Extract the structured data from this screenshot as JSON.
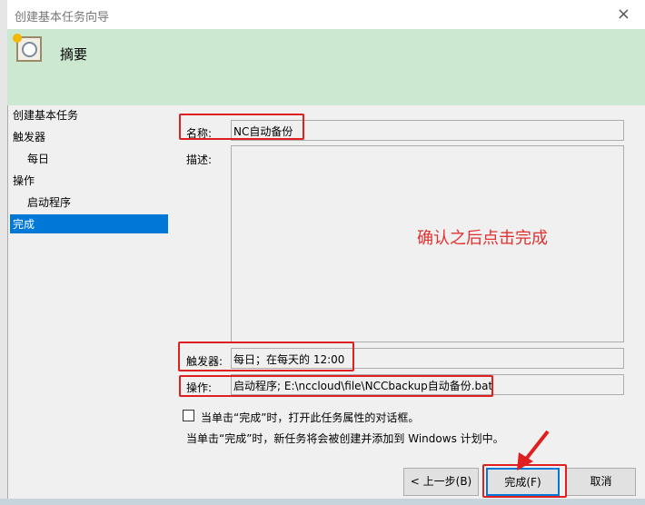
{
  "window": {
    "title": "创建基本任务向导",
    "close_icon": "×"
  },
  "header": {
    "title": "摘要"
  },
  "nav": {
    "items": [
      "创建基本任务",
      "触发器",
      "每日",
      "操作",
      "启动程序",
      "完成"
    ],
    "selected": "完成"
  },
  "fields": {
    "name_label": "名称:",
    "name_value": "NC自动备份",
    "desc_label": "描述:",
    "desc_value": "",
    "trigger_label": "触发器:",
    "trigger_value": "每日；在每天的 12:00",
    "action_label": "操作:",
    "action_value": "启动程序; E:\\nccloud\\file\\NCCbackup自动备份.bat"
  },
  "checkbox": {
    "label": "当单击“完成”时，打开此任务属性的对话框。",
    "checked": false
  },
  "info": "当单击“完成”时，新任务将会被创建并添加到 Windows 计划中。",
  "buttons": {
    "back": "< 上一步(B)",
    "finish": "完成(F)",
    "cancel": "取消"
  },
  "annotation": {
    "note": "确认之后点击完成",
    "color": "#e02020"
  }
}
